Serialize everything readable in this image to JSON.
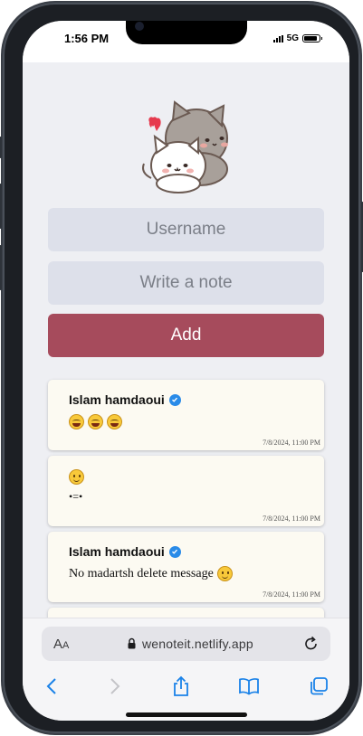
{
  "status_bar": {
    "time": "1:56 PM",
    "network": "5G",
    "battery_level": 0.9
  },
  "form": {
    "username_placeholder": "Username",
    "note_placeholder": "Write a note",
    "add_label": "Add"
  },
  "notes": [
    {
      "author": "Islam hamdaoui",
      "verified": true,
      "text": "",
      "emojis": [
        "laughing-emoji",
        "laughing-emoji",
        "laughing-emoji"
      ],
      "date": "7/8/2024, 11:00 PM"
    },
    {
      "author": "",
      "verified": false,
      "text": "•=•",
      "emojis": [
        "smiling-emoji"
      ],
      "date": "7/8/2024, 11:00 PM"
    },
    {
      "author": "Islam hamdaoui",
      "verified": true,
      "text": "No madartsh delete message",
      "emojis": [
        "smiling-emoji"
      ],
      "date": "7/8/2024, 11:00 PM"
    }
  ],
  "browser": {
    "text_size_label": "AA",
    "url": "wenoteit.netlify.app",
    "toolbar_icons": [
      "back-icon",
      "forward-icon",
      "share-icon",
      "bookmarks-icon",
      "tabs-icon"
    ]
  },
  "colors": {
    "accent": "#a64b5c",
    "input_bg": "#dde0ea",
    "note_bg": "#fcfaf2",
    "page_bg": "#eeeff3",
    "link_blue": "#1a82e8"
  }
}
